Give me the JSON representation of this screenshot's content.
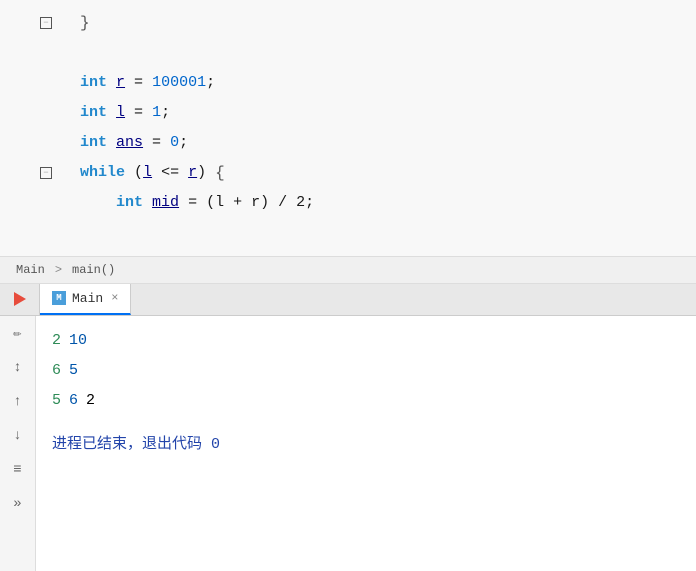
{
  "editor": {
    "lines": [
      {
        "id": "line-brace",
        "content": "}"
      },
      {
        "id": "line-blank1",
        "content": ""
      },
      {
        "id": "line-r",
        "keyword": "int",
        "varname": "r",
        "op": " = ",
        "value": "100001",
        "semi": ";"
      },
      {
        "id": "line-l",
        "keyword": "int",
        "varname": "l",
        "op": " = ",
        "value": "1",
        "semi": ";"
      },
      {
        "id": "line-ans",
        "keyword": "int",
        "varname": "ans",
        "op": " = ",
        "value": "0",
        "semi": ";"
      },
      {
        "id": "line-while",
        "content": "while (l <= r) {"
      },
      {
        "id": "line-mid",
        "content": "    int mid = (l + r) / 2;"
      }
    ]
  },
  "breadcrumb": {
    "item1": "Main",
    "separator": ">",
    "item2": "main()"
  },
  "tabs": {
    "active": "Main",
    "close_label": "×",
    "icon_label": "M"
  },
  "output": {
    "line1_green": "2",
    "line1_blue": "10",
    "line2_green": "6",
    "line2_blue": "5",
    "line3_green": "5",
    "line3_blue": "6",
    "line3_black": "2",
    "process_text": "进程已结束，退出代码 0"
  },
  "sidebar_icons": {
    "pencil": "✏",
    "sort": "↕",
    "up": "↑",
    "down": "↓",
    "list": "≡",
    "expand": "»"
  }
}
